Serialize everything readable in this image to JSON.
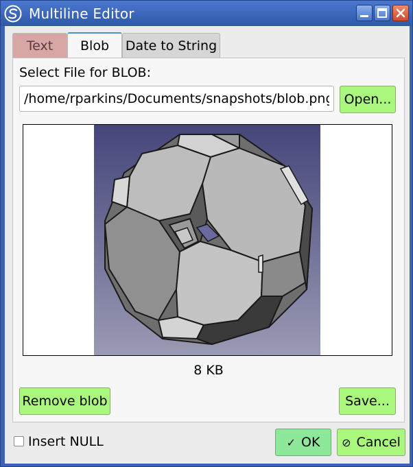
{
  "window": {
    "title": "Multiline Editor"
  },
  "tabs": [
    {
      "label": "Text"
    },
    {
      "label": "Blob"
    },
    {
      "label": "Date to String"
    }
  ],
  "blob": {
    "select_label": "Select File for BLOB:",
    "path_value": "/home/rparkins/Documents/snapshots/blob.png",
    "open_label": "Open...",
    "size_text": "8 KB",
    "remove_label": "Remove blob",
    "save_label": "Save..."
  },
  "footer": {
    "insert_null_label": "Insert NULL",
    "ok_label": "OK",
    "cancel_label": "Cancel"
  },
  "colors": {
    "button_green": "#aaf77e",
    "ok_green": "#8ee89a",
    "title_bar": "#3a63b8",
    "text_tab": "#d9a6a6"
  }
}
